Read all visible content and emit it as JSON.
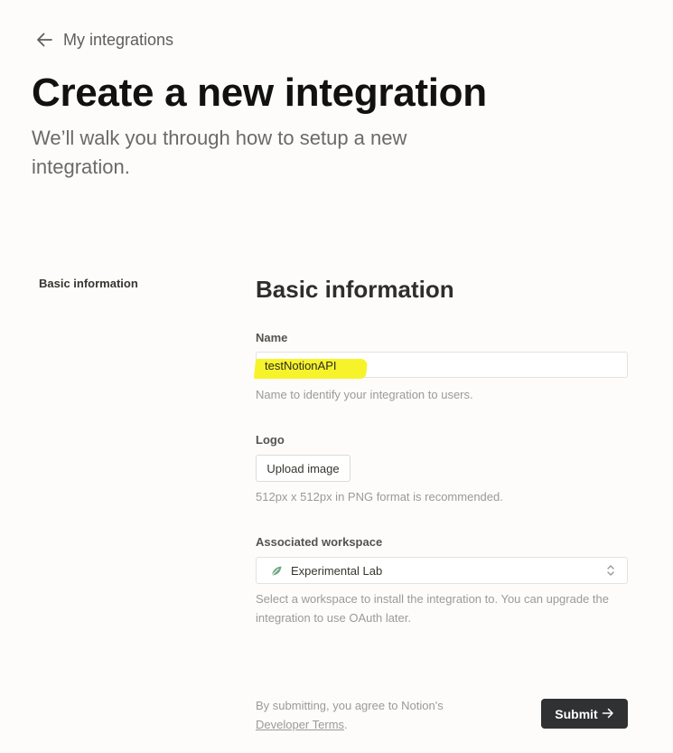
{
  "nav": {
    "back_label": "My integrations",
    "back_icon": "arrow-left-icon"
  },
  "header": {
    "title": "Create a new integration",
    "subtitle": "We’ll walk you through how to setup a new integration."
  },
  "sidebar": {
    "items": [
      {
        "label": "Basic information"
      }
    ]
  },
  "form": {
    "section_title": "Basic information",
    "name": {
      "label": "Name",
      "value": "testNotionAPI",
      "hint": "Name to identify your integration to users.",
      "highlight_color": "#f7f32a"
    },
    "logo": {
      "label": "Logo",
      "button_label": "Upload image",
      "hint": "512px x 512px in PNG format is recommended."
    },
    "workspace": {
      "label": "Associated workspace",
      "selected": "Experimental Lab",
      "icon": "leaf-icon",
      "icon_color": "#6fa882",
      "hint": "Select a workspace to install the integration to. You can upgrade the integration to use OAuth later."
    },
    "footer": {
      "terms_prefix": "By submitting, you agree to Notion's",
      "terms_link": "Developer Terms",
      "terms_suffix": ".",
      "submit_label": "Submit",
      "submit_icon": "arrow-right-icon"
    }
  },
  "colors": {
    "background": "#fdfcfb",
    "text_primary": "#37352f",
    "text_muted": "#9b9a97",
    "button_dark": "#2f3133"
  }
}
